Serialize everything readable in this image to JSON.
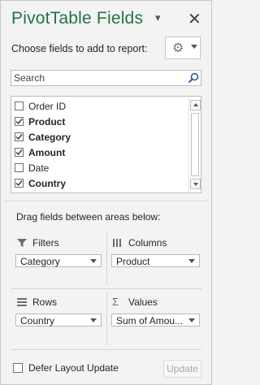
{
  "header": {
    "title": "PivotTable Fields",
    "dropdown_glyph": "▾",
    "close_glyph": "✕"
  },
  "choose_label": "Choose fields to add to report:",
  "settings_icon": "gear-icon",
  "search": {
    "placeholder": "Search"
  },
  "fields": [
    {
      "label": "Order ID",
      "checked": false
    },
    {
      "label": "Product",
      "checked": true
    },
    {
      "label": "Category",
      "checked": true
    },
    {
      "label": "Amount",
      "checked": true
    },
    {
      "label": "Date",
      "checked": false
    },
    {
      "label": "Country",
      "checked": true
    }
  ],
  "areas_label": "Drag fields between areas below:",
  "areas": {
    "filters": {
      "title": "Filters",
      "value": "Category"
    },
    "columns": {
      "title": "Columns",
      "value": "Product"
    },
    "rows": {
      "title": "Rows",
      "value": "Country"
    },
    "values": {
      "title": "Values",
      "value": "Sum of Amou..."
    }
  },
  "footer": {
    "defer_label": "Defer Layout Update",
    "defer_checked": false,
    "update_label": "Update"
  },
  "colors": {
    "title": "#217346",
    "text": "#262626",
    "background": "#f3f3f3"
  }
}
